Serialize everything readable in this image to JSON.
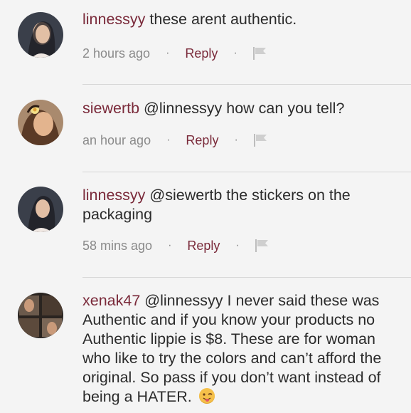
{
  "comments": [
    {
      "username": "linnessyy",
      "text": "these arent authentic.",
      "time": "2 hours ago",
      "reply_label": "Reply"
    },
    {
      "username": "siewertb",
      "text": "@linnessyy how can you tell?",
      "time": "an hour ago",
      "reply_label": "Reply"
    },
    {
      "username": "linnessyy",
      "text": "@siewertb the stickers on the packaging",
      "time": "58 mins ago",
      "reply_label": "Reply"
    },
    {
      "username": "xenak47",
      "text": "@linnessyy I never said these was Authentic and if you know your products no Authentic lippie is $8. These are for woman who like to try the colors and can’t afford the original. So pass if you don’t want instead of being a HATER.",
      "emoji": "winking-tongue-emoji"
    }
  ],
  "separator": "·",
  "colors": {
    "username": "#7a2a3a",
    "text": "#2b2b2b",
    "meta": "#8a8a8a",
    "background": "#f4f4f4",
    "divider": "#d6d6d6"
  },
  "icons": {
    "flag": "flag-icon"
  }
}
